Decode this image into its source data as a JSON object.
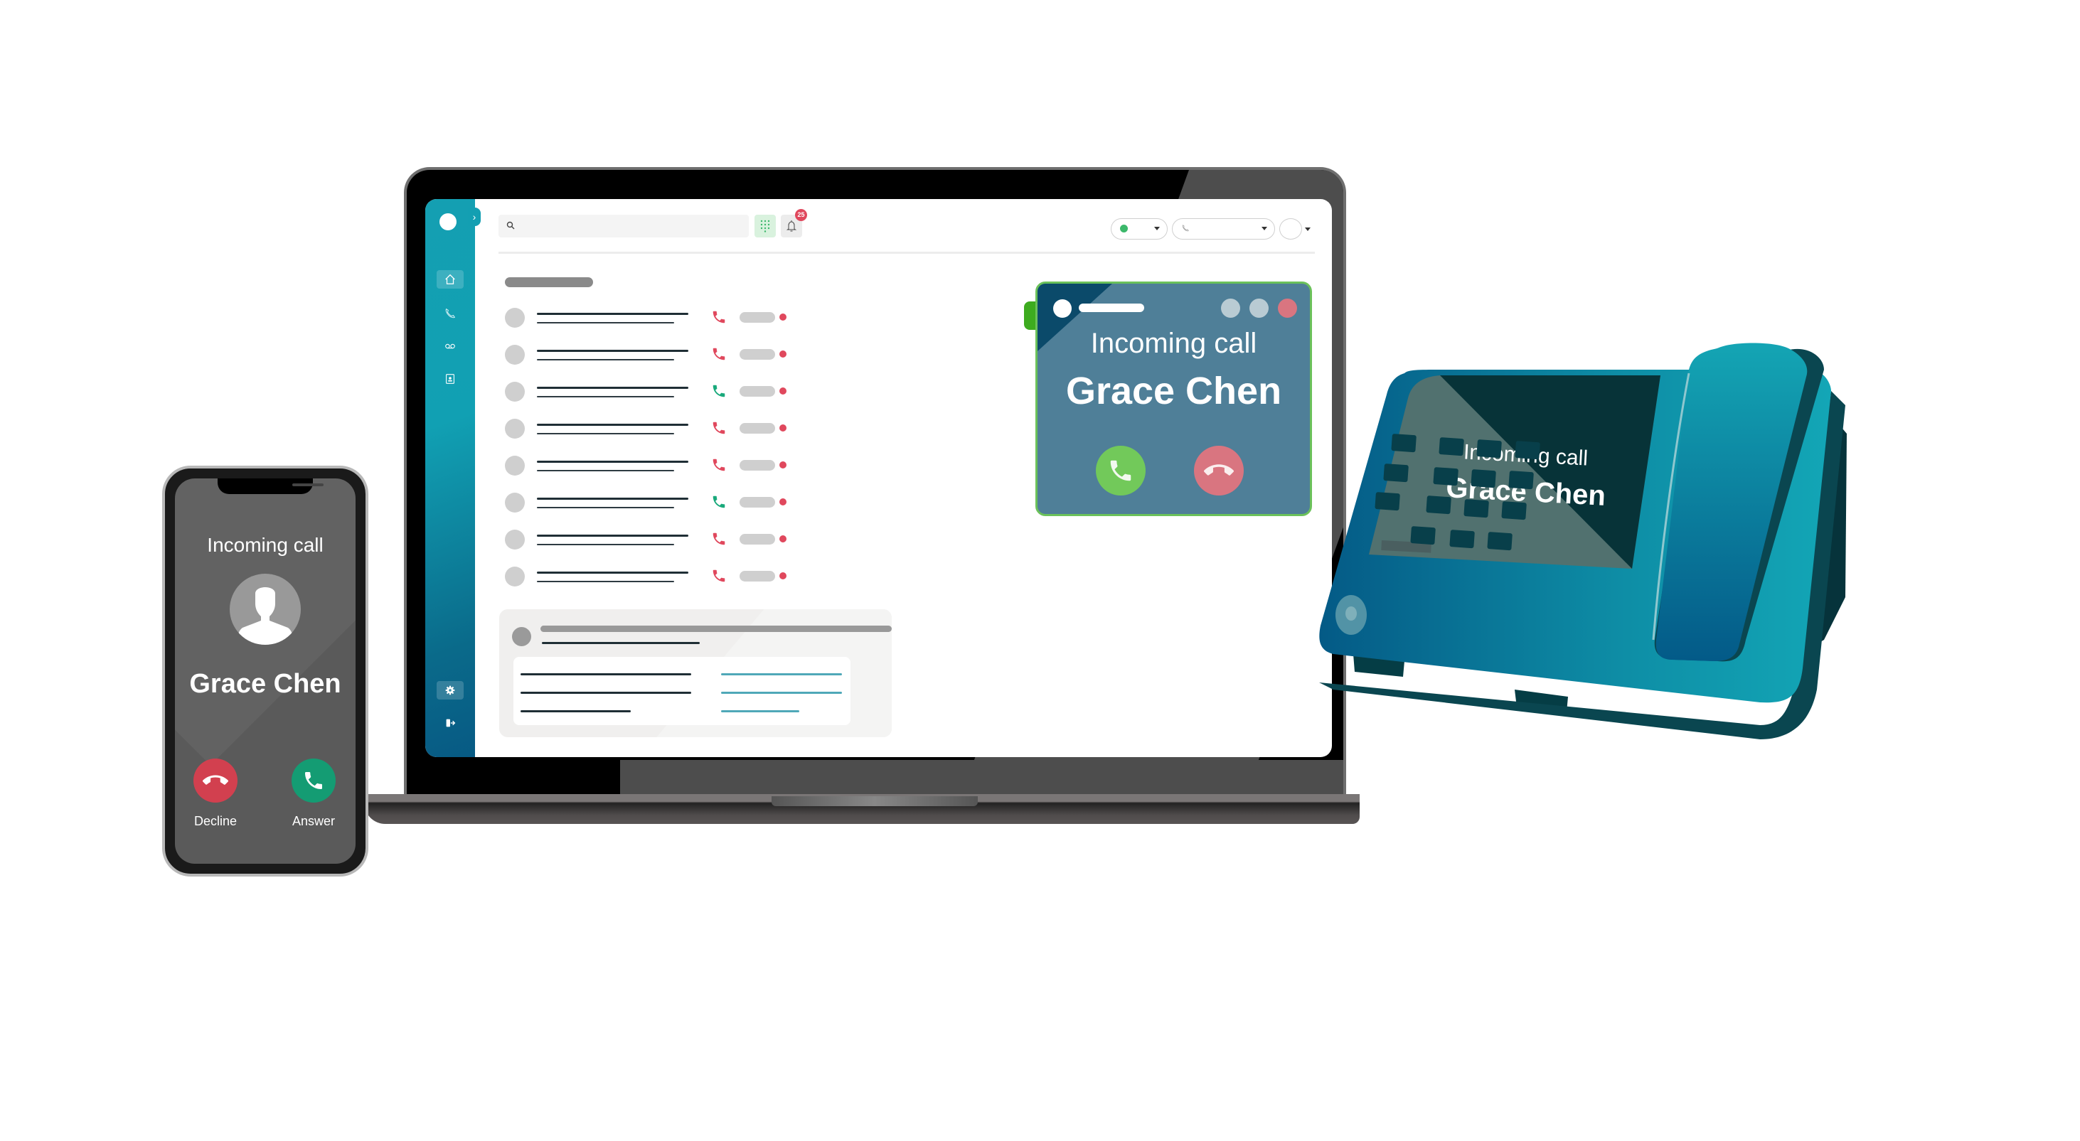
{
  "scene": "Incoming call shown simultaneously on mobile, desktop softphone app, and desk phone",
  "desktop_app": {
    "sidebar": {
      "toggle_glyph": "›",
      "items": [
        {
          "name": "home",
          "icon": "home-icon",
          "active": true
        },
        {
          "name": "calls",
          "icon": "phone-icon",
          "active": false
        },
        {
          "name": "voicemail",
          "icon": "voicemail-icon",
          "active": false
        },
        {
          "name": "contacts",
          "icon": "contact-card-icon",
          "active": false
        }
      ],
      "bottom_items": [
        {
          "name": "settings",
          "icon": "gear-icon",
          "active": true
        },
        {
          "name": "logout",
          "icon": "logout-icon",
          "active": false
        }
      ]
    },
    "topbar": {
      "search_placeholder": "",
      "notifications_count": "25",
      "status_color": "#3cb86b"
    },
    "call_history": [
      {
        "direction": "missed",
        "color": "#e0485d"
      },
      {
        "direction": "missed",
        "color": "#e0485d"
      },
      {
        "direction": "answered",
        "color": "#19a97b"
      },
      {
        "direction": "missed",
        "color": "#e0485d"
      },
      {
        "direction": "missed",
        "color": "#e0485d"
      },
      {
        "direction": "answered",
        "color": "#19a97b"
      },
      {
        "direction": "missed",
        "color": "#e0485d"
      },
      {
        "direction": "missed",
        "color": "#e0485d"
      }
    ],
    "incoming_popup": {
      "label": "Incoming call",
      "caller": "Grace Chen",
      "window_dots": [
        "#b9cbd3",
        "#b9cbd3",
        "#d97580"
      ],
      "answer_color": "#72c95a",
      "decline_color": "#d97580"
    }
  },
  "mobile": {
    "label": "Incoming call",
    "caller": "Grace Chen",
    "decline_label": "Decline",
    "answer_label": "Answer",
    "decline_color": "#d2404f",
    "answer_color": "#149c73"
  },
  "desk_phone": {
    "label": "Incoming call",
    "caller": "Grace Chen"
  }
}
